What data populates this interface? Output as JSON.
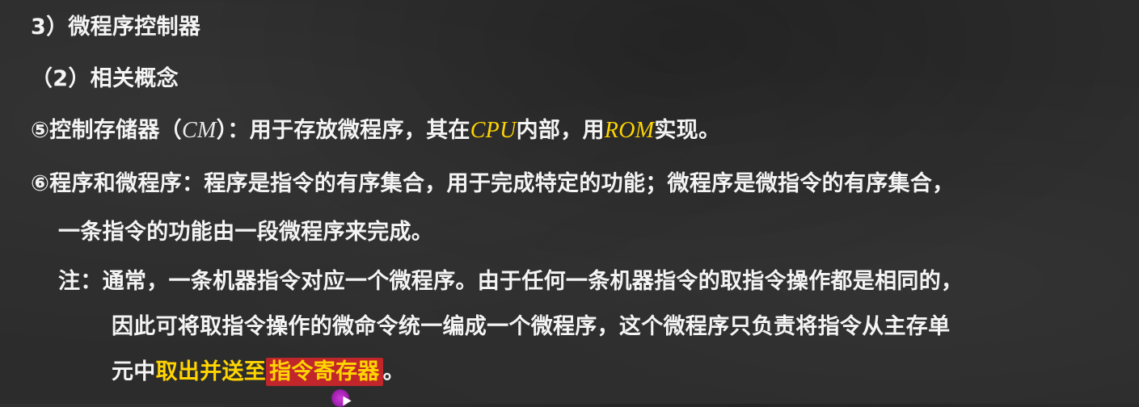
{
  "slide": {
    "heading1": "3）微程序控制器",
    "heading2": "（2）相关概念",
    "item5": {
      "prefix": "⑤控制存储器（",
      "cm": "CM",
      "mid1": "）：用于存放微程序，其在",
      "cpu": "CPU",
      "mid2": "内部，用",
      "rom": "ROM",
      "suffix": "实现。"
    },
    "item6": {
      "line1": "⑥程序和微程序：程序是指令的有序集合，用于完成特定的功能；微程序是微指令的有序集合，",
      "line2": "一条指令的功能由一段微程序来完成。"
    },
    "note": {
      "line1": "注：通常，一条机器指令对应一个微程序。由于任何一条机器指令的取指令操作都是相同的，",
      "line2": "因此可将取指令操作的微命令统一编成一个微程序，这个微程序只负责将指令从主存单",
      "line3_prefix": "元中",
      "line3_yellow": "取出并送至",
      "line3_highlight": "指令寄存器",
      "line3_suffix": "。"
    }
  },
  "colors": {
    "background": "#2c2c2c",
    "text": "#f4f4f4",
    "accent_yellow": "#ffd500",
    "highlight_red": "#c0262a",
    "cursor_magenta": "#c030d0"
  }
}
